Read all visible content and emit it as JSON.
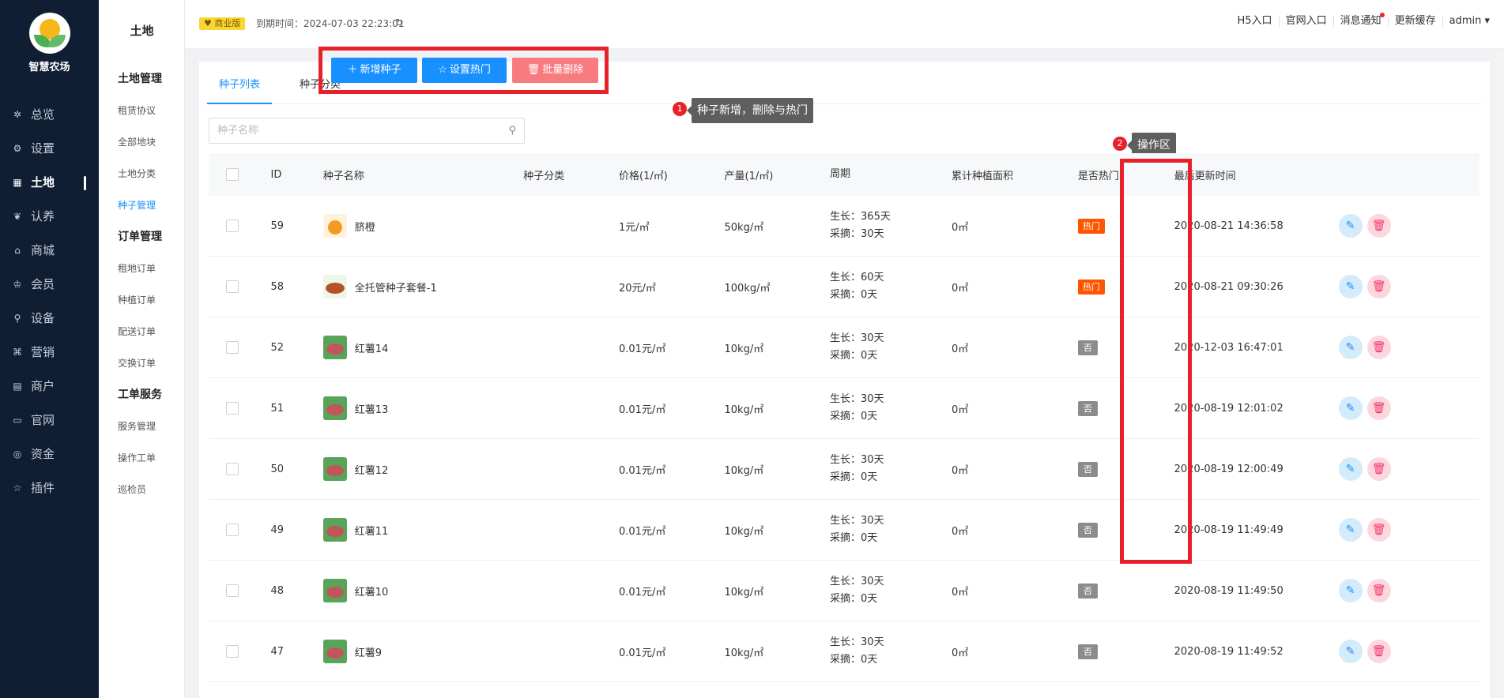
{
  "brand": {
    "name": "智慧农场"
  },
  "sidebar": {
    "items": [
      {
        "label": "总览",
        "icon": "dashboard-icon",
        "glyph": "✲"
      },
      {
        "label": "设置",
        "icon": "gear-icon",
        "glyph": "⚙"
      },
      {
        "label": "土地",
        "icon": "grid-icon",
        "glyph": "▦",
        "active": true
      },
      {
        "label": "认养",
        "icon": "paw-icon",
        "glyph": "❦"
      },
      {
        "label": "商城",
        "icon": "store-icon",
        "glyph": "⌂"
      },
      {
        "label": "会员",
        "icon": "crown-icon",
        "glyph": "♔"
      },
      {
        "label": "设备",
        "icon": "device-icon",
        "glyph": "⚲"
      },
      {
        "label": "营销",
        "icon": "marketing-icon",
        "glyph": "⌘"
      },
      {
        "label": "商户",
        "icon": "merchant-icon",
        "glyph": "▤"
      },
      {
        "label": "官网",
        "icon": "website-icon",
        "glyph": "▭"
      },
      {
        "label": "资金",
        "icon": "money-icon",
        "glyph": "◎"
      },
      {
        "label": "插件",
        "icon": "plugin-icon",
        "glyph": "☆"
      }
    ]
  },
  "subsidebar": {
    "title": "土地",
    "groups": [
      {
        "head": "土地管理",
        "items": [
          "租赁协议",
          "全部地块",
          "土地分类",
          "种子管理"
        ]
      },
      {
        "head": "订单管理",
        "items": [
          "租地订单",
          "种植订单",
          "配送订单",
          "交换订单"
        ]
      },
      {
        "head": "工单服务",
        "items": [
          "服务管理",
          "操作工单",
          "巡检员"
        ]
      }
    ],
    "active_item": "种子管理"
  },
  "topbar": {
    "version_badge": "商业版",
    "expire_text": "到期时间：2024-07-03 22:23:01",
    "links": [
      "H5入口",
      "官网入口",
      "消息通知",
      "更新缓存",
      "admin ▾"
    ]
  },
  "tabs": [
    "种子列表",
    "种子分类"
  ],
  "active_tab": "种子列表",
  "search": {
    "placeholder": "种子名称",
    "value": ""
  },
  "buttons": {
    "add": "新增种子",
    "hot": "设置热门",
    "delete": "批量删除"
  },
  "annotations": [
    {
      "num": "1",
      "text": "种子新增，删除与热门"
    },
    {
      "num": "2",
      "text": "操作区"
    }
  ],
  "table": {
    "headers": [
      "ID",
      "种子名称",
      "种子分类",
      "价格(1/㎡)",
      "产量(1/㎡)",
      "周期",
      "累计种植面积",
      "是否热门",
      "最后更新时间"
    ],
    "rows": [
      {
        "id": "59",
        "name": "脐橙",
        "thumb": "orange",
        "category": "",
        "price": "1元/㎡",
        "yield": "50kg/㎡",
        "grow": "生长：365天",
        "pick": "采摘：30天",
        "area": "0㎡",
        "hot": "热门",
        "is_hot": true,
        "time": "2020-08-21 14:36:58"
      },
      {
        "id": "58",
        "name": "全托管种子套餐-1",
        "thumb": "veg",
        "category": "",
        "price": "20元/㎡",
        "yield": "100kg/㎡",
        "grow": "生长：60天",
        "pick": "采摘：0天",
        "area": "0㎡",
        "hot": "热门",
        "is_hot": true,
        "time": "2020-08-21 09:30:26"
      },
      {
        "id": "52",
        "name": "红薯14",
        "thumb": "sweet",
        "category": "",
        "price": "0.01元/㎡",
        "yield": "10kg/㎡",
        "grow": "生长：30天",
        "pick": "采摘：0天",
        "area": "0㎡",
        "hot": "否",
        "is_hot": false,
        "time": "2020-12-03 16:47:01"
      },
      {
        "id": "51",
        "name": "红薯13",
        "thumb": "sweet",
        "category": "",
        "price": "0.01元/㎡",
        "yield": "10kg/㎡",
        "grow": "生长：30天",
        "pick": "采摘：0天",
        "area": "0㎡",
        "hot": "否",
        "is_hot": false,
        "time": "2020-08-19 12:01:02"
      },
      {
        "id": "50",
        "name": "红薯12",
        "thumb": "sweet",
        "category": "",
        "price": "0.01元/㎡",
        "yield": "10kg/㎡",
        "grow": "生长：30天",
        "pick": "采摘：0天",
        "area": "0㎡",
        "hot": "否",
        "is_hot": false,
        "time": "2020-08-19 12:00:49"
      },
      {
        "id": "49",
        "name": "红薯11",
        "thumb": "sweet",
        "category": "",
        "price": "0.01元/㎡",
        "yield": "10kg/㎡",
        "grow": "生长：30天",
        "pick": "采摘：0天",
        "area": "0㎡",
        "hot": "否",
        "is_hot": false,
        "time": "2020-08-19 11:49:49"
      },
      {
        "id": "48",
        "name": "红薯10",
        "thumb": "sweet",
        "category": "",
        "price": "0.01元/㎡",
        "yield": "10kg/㎡",
        "grow": "生长：30天",
        "pick": "采摘：0天",
        "area": "0㎡",
        "hot": "否",
        "is_hot": false,
        "time": "2020-08-19 11:49:50"
      },
      {
        "id": "47",
        "name": "红薯9",
        "thumb": "sweet",
        "category": "",
        "price": "0.01元/㎡",
        "yield": "10kg/㎡",
        "grow": "生长：30天",
        "pick": "采摘：0天",
        "area": "0㎡",
        "hot": "否",
        "is_hot": false,
        "time": "2020-08-19 11:49:52"
      }
    ]
  },
  "colors": {
    "primary": "#1890ff",
    "danger": "#f87c7f",
    "sidebar_bg": "#0f1e33",
    "hot_tag": "#ff5500",
    "annotation": "#e8202a"
  }
}
